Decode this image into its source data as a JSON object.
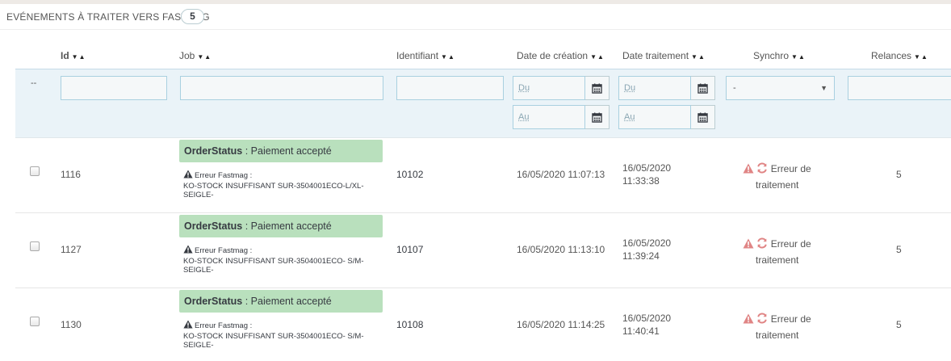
{
  "panel": {
    "title": "Evénements à traiter vers Fastmag",
    "count": "5"
  },
  "columns": {
    "id": "Id",
    "job": "Job",
    "identifiant": "Identifiant",
    "date_creation": "Date de création",
    "date_traitement": "Date traitement",
    "synchro": "Synchro",
    "relances": "Relances",
    "sort_glyph": "▼▲"
  },
  "filters": {
    "dash": "--",
    "du": "Du",
    "au": "Au",
    "synchro_selected": "-",
    "select_arrow": "▼"
  },
  "rows": [
    {
      "id": "1116",
      "job_label": "OrderStatus",
      "job_sep": " : ",
      "job_value": "Paiement accepté",
      "error_title": "Erreur Fastmag :",
      "error_line1": "KO-STOCK INSUFFISANT SUR-3504001ECO-L/XL-",
      "error_line2": "SEIGLE-",
      "identifiant": "10102",
      "date_creation": "16/05/2020 11:07:13",
      "date_traitement_1": "16/05/2020",
      "date_traitement_2": "11:33:38",
      "synchro_1": "Erreur de",
      "synchro_2": "traitement",
      "relances": "5"
    },
    {
      "id": "1127",
      "job_label": "OrderStatus",
      "job_sep": " : ",
      "job_value": "Paiement accepté",
      "error_title": "Erreur Fastmag :",
      "error_line1": "KO-STOCK INSUFFISANT SUR-3504001ECO- S/M-",
      "error_line2": "SEIGLE-",
      "identifiant": "10107",
      "date_creation": "16/05/2020 11:13:10",
      "date_traitement_1": "16/05/2020",
      "date_traitement_2": "11:39:24",
      "synchro_1": "Erreur de",
      "synchro_2": "traitement",
      "relances": "5"
    },
    {
      "id": "1130",
      "job_label": "OrderStatus",
      "job_sep": " : ",
      "job_value": "Paiement accepté",
      "error_title": "Erreur Fastmag :",
      "error_line1": "KO-STOCK INSUFFISANT SUR-3504001ECO- S/M-",
      "error_line2": "SEIGLE-",
      "identifiant": "10108",
      "date_creation": "16/05/2020 11:14:25",
      "date_traitement_1": "16/05/2020",
      "date_traitement_2": "11:40:41",
      "synchro_1": "Erreur de",
      "synchro_2": "traitement",
      "relances": "5"
    }
  ],
  "icons": {
    "warning": "warning-icon",
    "refresh": "refresh-icon",
    "calendar": "calendar-icon",
    "error_color": "#e08585"
  }
}
